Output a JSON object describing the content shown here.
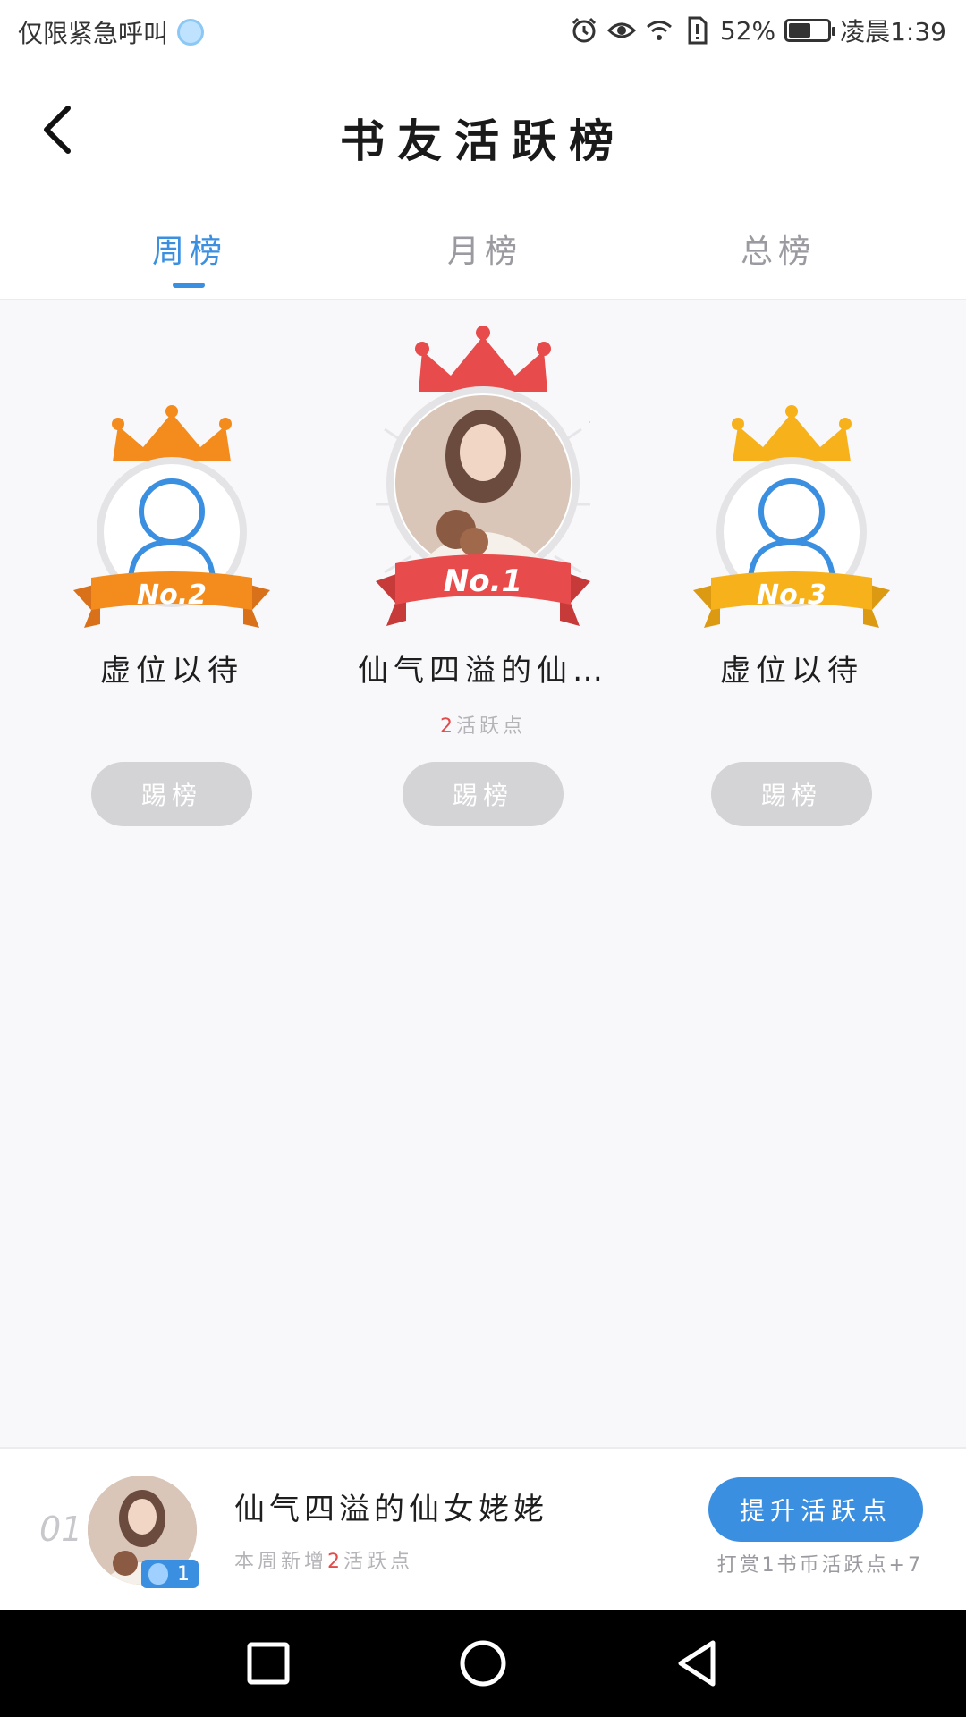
{
  "status_bar": {
    "carrier": "仅限紧急呼叫",
    "battery_percent": "52%",
    "time": "凌晨1:39"
  },
  "header": {
    "title": "书友活跃榜"
  },
  "tabs": [
    {
      "label": "周榜",
      "active": true
    },
    {
      "label": "月榜",
      "active": false
    },
    {
      "label": "总榜",
      "active": false
    }
  ],
  "podium": [
    {
      "rank_label": "No.2",
      "name": "虚位以待",
      "points": "",
      "points_unit": "",
      "button": "踢榜",
      "ribbon_color": "#f48c1d"
    },
    {
      "rank_label": "No.1",
      "name": "仙气四溢的仙…",
      "points": "2",
      "points_unit": "活跃点",
      "button": "踢榜",
      "ribbon_color": "#e84b4b"
    },
    {
      "rank_label": "No.3",
      "name": "虚位以待",
      "points": "",
      "points_unit": "",
      "button": "踢榜",
      "ribbon_color": "#f7b21b"
    }
  ],
  "my_rank": {
    "rank": "01",
    "level": "1",
    "name": "仙气四溢的仙女姥姥",
    "sub_prefix": "本周新增",
    "sub_points": "2",
    "sub_suffix": "活跃点",
    "boost_button": "提升活跃点",
    "hint": "打赏1书币活跃点+7"
  },
  "colors": {
    "accent": "#3a8fe0",
    "gold": "#f7b21b",
    "silver_orange": "#f48c1d",
    "red": "#e84b4b"
  }
}
